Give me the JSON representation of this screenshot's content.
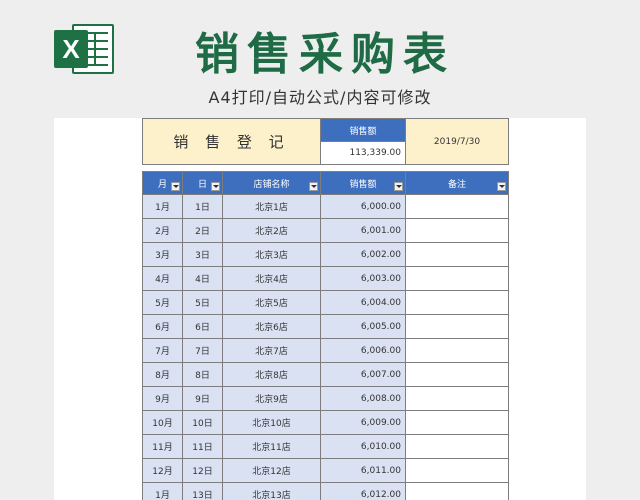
{
  "header": {
    "logo_letter": "X",
    "title": "销售采购表",
    "subtitle": "A4打印/自动公式/内容可修改"
  },
  "summary": {
    "title": "销 售 登 记",
    "sales_label": "销售额",
    "sales_total": "113,339.00",
    "date": "2019/7/30"
  },
  "table": {
    "columns": [
      "月",
      "日",
      "店铺名称",
      "销售额",
      "备注"
    ],
    "rows": [
      {
        "month": "1月",
        "day": "1日",
        "store": "北京1店",
        "sales": "6,000.00",
        "note": ""
      },
      {
        "month": "2月",
        "day": "2日",
        "store": "北京2店",
        "sales": "6,001.00",
        "note": ""
      },
      {
        "month": "3月",
        "day": "3日",
        "store": "北京3店",
        "sales": "6,002.00",
        "note": ""
      },
      {
        "month": "4月",
        "day": "4日",
        "store": "北京4店",
        "sales": "6,003.00",
        "note": ""
      },
      {
        "month": "5月",
        "day": "5日",
        "store": "北京5店",
        "sales": "6,004.00",
        "note": ""
      },
      {
        "month": "6月",
        "day": "6日",
        "store": "北京6店",
        "sales": "6,005.00",
        "note": ""
      },
      {
        "month": "7月",
        "day": "7日",
        "store": "北京7店",
        "sales": "6,006.00",
        "note": ""
      },
      {
        "month": "8月",
        "day": "8日",
        "store": "北京8店",
        "sales": "6,007.00",
        "note": ""
      },
      {
        "month": "9月",
        "day": "9日",
        "store": "北京9店",
        "sales": "6,008.00",
        "note": ""
      },
      {
        "month": "10月",
        "day": "10日",
        "store": "北京10店",
        "sales": "6,009.00",
        "note": ""
      },
      {
        "month": "11月",
        "day": "11日",
        "store": "北京11店",
        "sales": "6,010.00",
        "note": ""
      },
      {
        "month": "12月",
        "day": "12日",
        "store": "北京12店",
        "sales": "6,011.00",
        "note": ""
      },
      {
        "month": "1月",
        "day": "13日",
        "store": "北京13店",
        "sales": "6,012.00",
        "note": ""
      }
    ]
  },
  "colors": {
    "brand_green": "#1e6b45",
    "header_blue": "#3e6fbf",
    "row_fill": "#d9e1f2",
    "title_fill": "#fdf1cc"
  },
  "icons": [
    "excel-logo-icon",
    "filter-dropdown-icon"
  ]
}
